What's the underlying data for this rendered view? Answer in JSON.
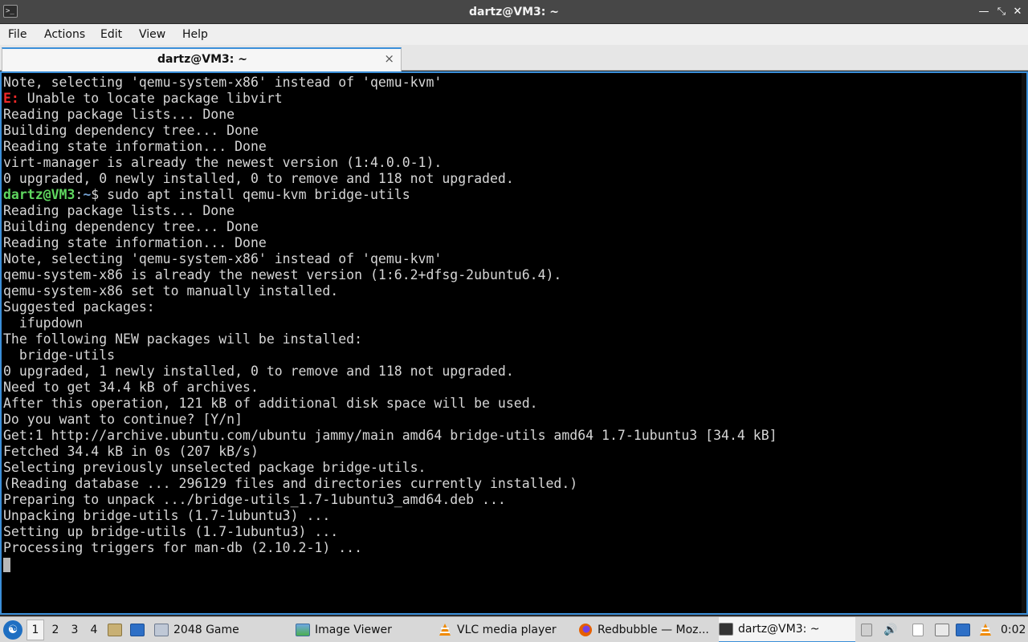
{
  "window": {
    "title": "dartz@VM3: ~"
  },
  "menu": [
    "File",
    "Actions",
    "Edit",
    "View",
    "Help"
  ],
  "tab": {
    "label": "dartz@VM3: ~",
    "close": "×"
  },
  "terminal": {
    "lines": [
      {
        "text": "Note, selecting 'qemu-system-x86' instead of 'qemu-kvm'"
      },
      {
        "err_prefix": "E:",
        "text": " Unable to locate package libvirt"
      },
      {
        "text": "Reading package lists... Done"
      },
      {
        "text": "Building dependency tree... Done"
      },
      {
        "text": "Reading state information... Done"
      },
      {
        "text": "virt-manager is already the newest version (1:4.0.0-1)."
      },
      {
        "text": "0 upgraded, 0 newly installed, 0 to remove and 118 not upgraded."
      },
      {
        "prompt_user": "dartz@VM3",
        "prompt_sep": ":",
        "prompt_path": "~",
        "prompt_sym": "$",
        "text": " sudo apt install qemu-kvm bridge-utils"
      },
      {
        "text": "Reading package lists... Done"
      },
      {
        "text": "Building dependency tree... Done"
      },
      {
        "text": "Reading state information... Done"
      },
      {
        "text": "Note, selecting 'qemu-system-x86' instead of 'qemu-kvm'"
      },
      {
        "text": "qemu-system-x86 is already the newest version (1:6.2+dfsg-2ubuntu6.4)."
      },
      {
        "text": "qemu-system-x86 set to manually installed."
      },
      {
        "text": "Suggested packages:"
      },
      {
        "text": "  ifupdown"
      },
      {
        "text": "The following NEW packages will be installed:"
      },
      {
        "text": "  bridge-utils"
      },
      {
        "text": "0 upgraded, 1 newly installed, 0 to remove and 118 not upgraded."
      },
      {
        "text": "Need to get 34.4 kB of archives."
      },
      {
        "text": "After this operation, 121 kB of additional disk space will be used."
      },
      {
        "text": "Do you want to continue? [Y/n]"
      },
      {
        "text": "Get:1 http://archive.ubuntu.com/ubuntu jammy/main amd64 bridge-utils amd64 1.7-1ubuntu3 [34.4 kB]"
      },
      {
        "text": "Fetched 34.4 kB in 0s (207 kB/s)"
      },
      {
        "text": "Selecting previously unselected package bridge-utils."
      },
      {
        "text": "(Reading database ... 296129 files and directories currently installed.)"
      },
      {
        "text": "Preparing to unpack .../bridge-utils_1.7-1ubuntu3_amd64.deb ..."
      },
      {
        "text": "Unpacking bridge-utils (1.7-1ubuntu3) ..."
      },
      {
        "text": "Setting up bridge-utils (1.7-1ubuntu3) ..."
      },
      {
        "text": "Processing triggers for man-db (2.10.2-1) ..."
      }
    ]
  },
  "taskbar": {
    "workspaces": [
      "1",
      "2",
      "3",
      "4"
    ],
    "active_workspace": "1",
    "tasks": [
      {
        "label": "2048 Game",
        "icon": "window-icon"
      },
      {
        "label": "Image Viewer",
        "icon": "image-viewer-icon"
      },
      {
        "label": "VLC media player",
        "icon": "vlc-icon"
      },
      {
        "label": "Redbubble — Moz...",
        "icon": "firefox-icon"
      },
      {
        "label": "dartz@VM3: ~",
        "icon": "terminal-icon"
      }
    ],
    "clock": "0:02"
  },
  "colors": {
    "accent": "#3b8fd9",
    "error": "#ef2929",
    "prompt_user": "#5fd75f",
    "prompt_path": "#729fcf"
  }
}
